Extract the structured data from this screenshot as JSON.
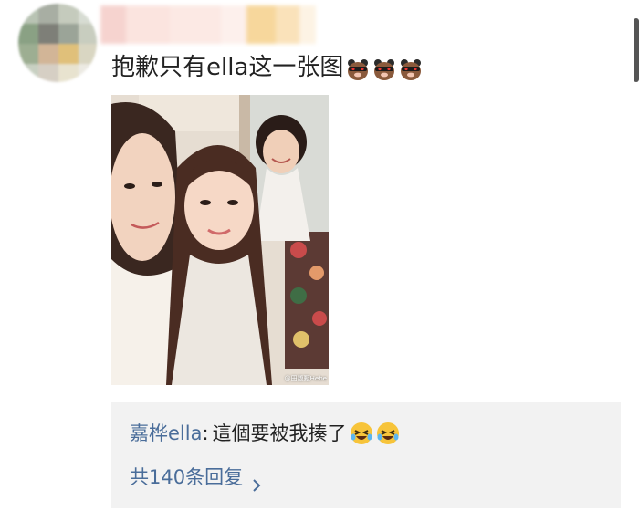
{
  "comment": {
    "text": "抱歉只有ella这一张图",
    "emoji_icons": [
      "bear-emoji-icon",
      "bear-emoji-icon",
      "bear-emoji-icon"
    ]
  },
  "photo": {
    "watermark": "@田馥甄Hebe"
  },
  "reply": {
    "author": "嘉桦ella",
    "colon": ":",
    "content": "這個要被我揍了",
    "emoji_icons": [
      "laughing-emoji-icon",
      "laughing-emoji-icon"
    ],
    "more_label": "共140条回复"
  },
  "colors": {
    "link": "#4a6d9a",
    "reply_bg": "#f2f2f2",
    "text": "#222222"
  }
}
